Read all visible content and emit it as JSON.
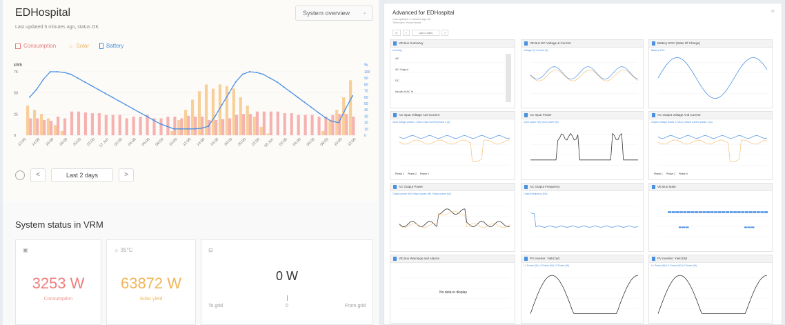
{
  "left": {
    "title": "EDHospital",
    "subtitle": "Last updated 5 minutes ago, status OK",
    "dropdown": "System overview",
    "legend": {
      "consumption": "Consumption",
      "solar": "Solar",
      "battery": "Battery"
    },
    "nav": {
      "period": "Last 2 days",
      "prev": "<",
      "next": ">"
    }
  },
  "chart_data": {
    "type": "bar",
    "ylabel_left": "kWh",
    "ylabel_right": "%",
    "ylim_left": [
      0,
      75
    ],
    "ylim_right": [
      0,
      100
    ],
    "yticks_left": [
      "0",
      "25",
      "50",
      "75"
    ],
    "yticks_right": [
      "0",
      "10",
      "20",
      "30",
      "40",
      "50",
      "60",
      "70",
      "80",
      "90",
      "100"
    ],
    "xticks": [
      "12:00",
      "14:00",
      "16:00",
      "18:00",
      "20:00",
      "22:00",
      "17 Jun",
      "02:00",
      "04:00",
      "06:00",
      "08:00",
      "10:00",
      "12:00",
      "14:00",
      "16:00",
      "18:00",
      "20:00",
      "22:00",
      "18 Jun",
      "02:00",
      "04:00",
      "06:00",
      "08:00",
      "10:00",
      "12:00"
    ],
    "series": [
      {
        "name": "Consumption",
        "color": "#f29a9a",
        "values": [
          20,
          20,
          18,
          17,
          22,
          20,
          28,
          28,
          27,
          26,
          26,
          24,
          24,
          24,
          20,
          22,
          22,
          24,
          20,
          20,
          22,
          22,
          20,
          23,
          22,
          22,
          18,
          18,
          19,
          20,
          24,
          25,
          25,
          28,
          28,
          28,
          28,
          26,
          26,
          24,
          24,
          24,
          22,
          22,
          24,
          25,
          25,
          22
        ]
      },
      {
        "name": "Solar",
        "color": "#f6c07a",
        "values": [
          35,
          30,
          25,
          20,
          12,
          5,
          0,
          0,
          0,
          0,
          0,
          0,
          0,
          0,
          0,
          0,
          0,
          0,
          0,
          0,
          0,
          5,
          18,
          30,
          42,
          52,
          60,
          55,
          60,
          58,
          55,
          45,
          35,
          22,
          10,
          2,
          0,
          0,
          0,
          0,
          0,
          0,
          0,
          5,
          18,
          30,
          45,
          65
        ]
      },
      {
        "name": "Battery",
        "color": "#4a90e2",
        "values": [
          60,
          72,
          88,
          100,
          100,
          99,
          96,
          90,
          84,
          78,
          72,
          66,
          60,
          54,
          48,
          42,
          36,
          30,
          24,
          18,
          14,
          10,
          10,
          10,
          10,
          11,
          14,
          30,
          48,
          66,
          84,
          96,
          100,
          99,
          96,
          90,
          84,
          76,
          68,
          60,
          52,
          44,
          36,
          28,
          22,
          20,
          42,
          62
        ]
      }
    ]
  },
  "bottom": {
    "heading": "System status in VRM",
    "consumption_value": "3253 W",
    "consumption_label": "Consumption",
    "solar_temp": "35°C",
    "solar_value": "63872 W",
    "solar_label": "Solar yield",
    "grid_value": "0 W",
    "to_grid": "To grid",
    "grid_mid": "0",
    "from_grid": "From grid"
  },
  "right": {
    "title": "Advanced for EDHospital",
    "sub1": "Last updated 4 minutes ago all",
    "sub2": "Timezone: Hour/minute",
    "period": "Last 2 days",
    "panels": [
      {
        "title": "VE.Bus Summary",
        "legend": "Inverting"
      },
      {
        "title": "VE.Bus DC Voltage & Current",
        "legend": "Voltage (V)   Current (A)"
      },
      {
        "title": "Battery SOC (State Of Charge)",
        "legend": "Battery SOC"
      },
      {
        "title": "AC Input Voltage And Current",
        "legend": "Input voltage phase 1 (VAC)   Input current phase 1 (A)"
      },
      {
        "title": "AC Input Power",
        "legend": "Input power (W)   Input power (W)"
      },
      {
        "title": "AC Output Voltage And Current",
        "legend": "Output voltage phase 1 (VAC)   Output current phase 1 (A)"
      },
      {
        "title": "AC Output Power",
        "legend": "Output power (W)   Output power (W)   Output power (W)"
      },
      {
        "title": "AC Output Frequency",
        "legend": "Output frequency (Hz)"
      },
      {
        "title": "VE.Bus State",
        "legend": ""
      },
      {
        "title": "VE.Bus Warnings and Alarms",
        "legend": ""
      },
      {
        "title": "PV Inverter: Yield (W)",
        "legend": "L1 Power (W)   L2 Power (W)   L3 Power (W)"
      },
      {
        "title": "PV Inverter: Yield (W)",
        "legend": "L1 Power (W)   L2 Power (W)   L3 Power (W)"
      }
    ],
    "no_data": "No data to display",
    "phase_tabs": [
      "Phase 1",
      "Phase 2",
      "Phase 3"
    ],
    "summary_rows": [
      "AC",
      "AC Output",
      "DC",
      "Inputs of AC in"
    ]
  },
  "colors": {
    "consumption": "#f29a9a",
    "solar": "#f6c07a",
    "battery": "#4a90e2"
  }
}
